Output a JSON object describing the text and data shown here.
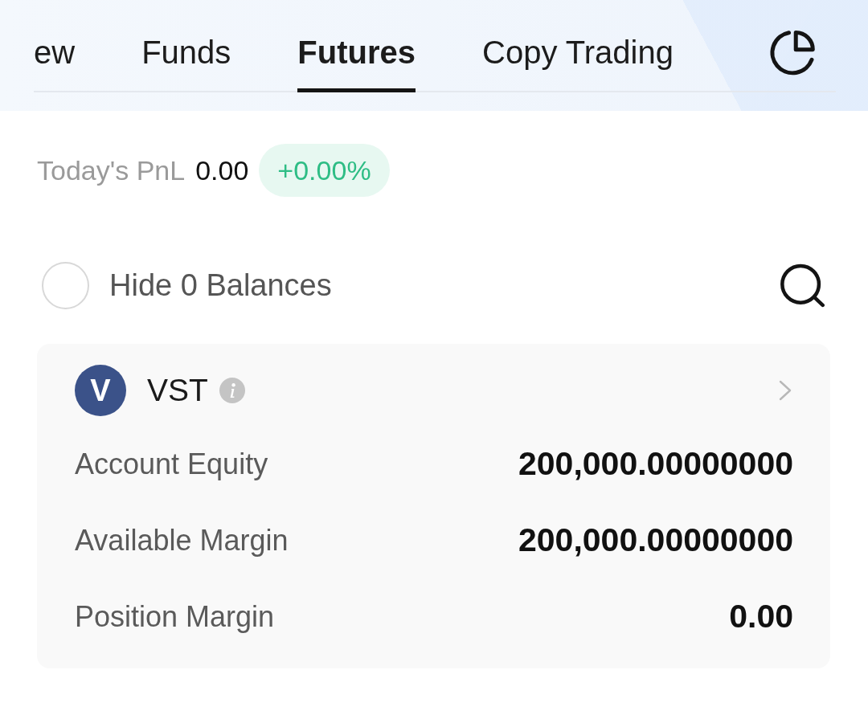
{
  "tabs": [
    {
      "label": "ew",
      "selected": false
    },
    {
      "label": "Funds",
      "selected": false
    },
    {
      "label": "Futures",
      "selected": true
    },
    {
      "label": "Copy Trading",
      "selected": false
    }
  ],
  "todays_pnl": {
    "label": "Today's PnL",
    "value": "0.00",
    "change": "+0.00%"
  },
  "hide_zero_balances": {
    "label": "Hide 0 Balances",
    "checked": false
  },
  "assets": [
    {
      "logo_text": "V",
      "name": "VST",
      "rows": [
        {
          "label": "Account Equity",
          "value": "200,000.00000000"
        },
        {
          "label": "Available Margin",
          "value": "200,000.00000000"
        },
        {
          "label": "Position Margin",
          "value": "0.00"
        }
      ]
    }
  ]
}
